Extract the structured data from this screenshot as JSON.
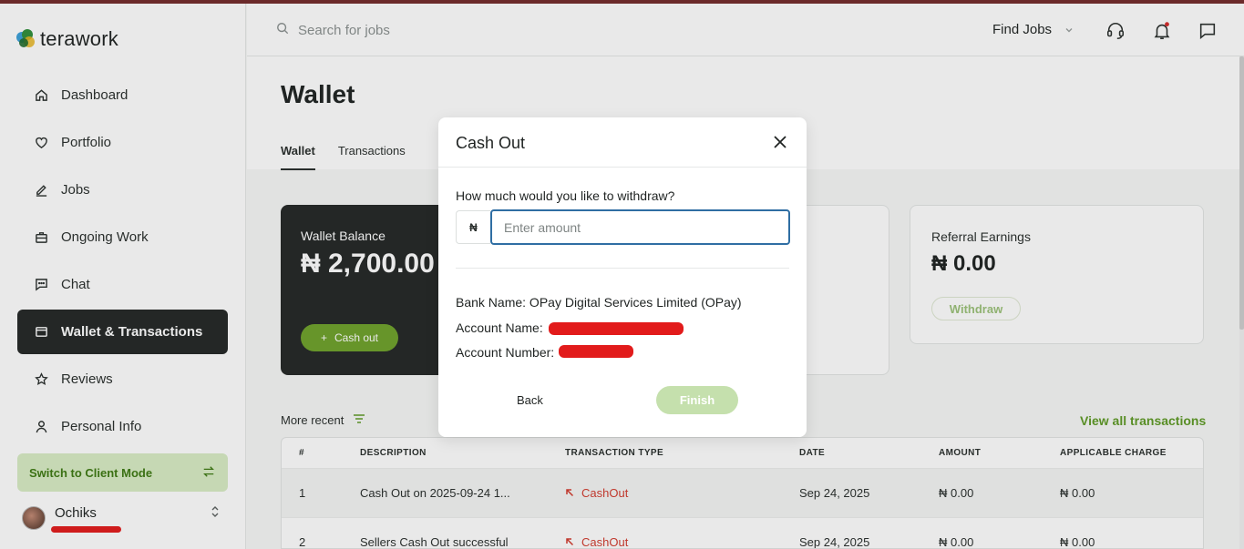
{
  "app": {
    "logo_text": "terawork"
  },
  "sidebar": {
    "items": [
      {
        "label": "Dashboard",
        "icon": "home-icon"
      },
      {
        "label": "Portfolio",
        "icon": "heart-icon"
      },
      {
        "label": "Jobs",
        "icon": "pencil-icon"
      },
      {
        "label": "Ongoing Work",
        "icon": "briefcase-icon"
      },
      {
        "label": "Chat",
        "icon": "chat-icon"
      },
      {
        "label": "Wallet & Transactions",
        "icon": "wallet-icon",
        "active": true
      },
      {
        "label": "Reviews",
        "icon": "star-icon"
      },
      {
        "label": "Personal Info",
        "icon": "user-icon"
      }
    ],
    "switch_label": "Switch to Client Mode",
    "user_name": "Ochiks"
  },
  "topbar": {
    "search_placeholder": "Search for jobs",
    "find_jobs": "Find Jobs"
  },
  "main": {
    "title": "Wallet",
    "tabs": [
      {
        "label": "Wallet",
        "active": true
      },
      {
        "label": "Transactions"
      }
    ],
    "balance": {
      "label": "Wallet Balance",
      "amount": "₦ 2,700.00",
      "button": "Cash out"
    },
    "referral": {
      "label": "Referral Earnings",
      "amount": "₦ 0.00",
      "button": "Withdraw"
    },
    "more_recent": "More recent",
    "view_all": "View all transactions",
    "table": {
      "headers": [
        "#",
        "DESCRIPTION",
        "TRANSACTION TYPE",
        "DATE",
        "AMOUNT",
        "APPLICABLE CHARGE"
      ],
      "rows": [
        {
          "num": "1",
          "description": "Cash Out on 2025-09-24 1...",
          "type": "CashOut",
          "date": "Sep 24, 2025",
          "amount": "₦ 0.00",
          "charge": "₦ 0.00"
        },
        {
          "num": "2",
          "description": "Sellers Cash Out successful",
          "type": "CashOut",
          "date": "Sep 24, 2025",
          "amount": "₦ 0.00",
          "charge": "₦ 0.00"
        }
      ]
    }
  },
  "modal": {
    "title": "Cash Out",
    "question": "How much would you like to withdraw?",
    "currency_symbol": "₦",
    "amount_placeholder": "Enter amount",
    "amount_value": "",
    "bank_name_line": "Bank Name: OPay Digital Services Limited (OPay)",
    "account_name_label": "Account Name:",
    "account_number_label": "Account Number:",
    "back": "Back",
    "finish": "Finish"
  },
  "colors": {
    "accent_green": "#6fa22b",
    "dark": "#242826",
    "cashout_red": "#d23b2e",
    "input_focus": "#2f6ea3"
  }
}
